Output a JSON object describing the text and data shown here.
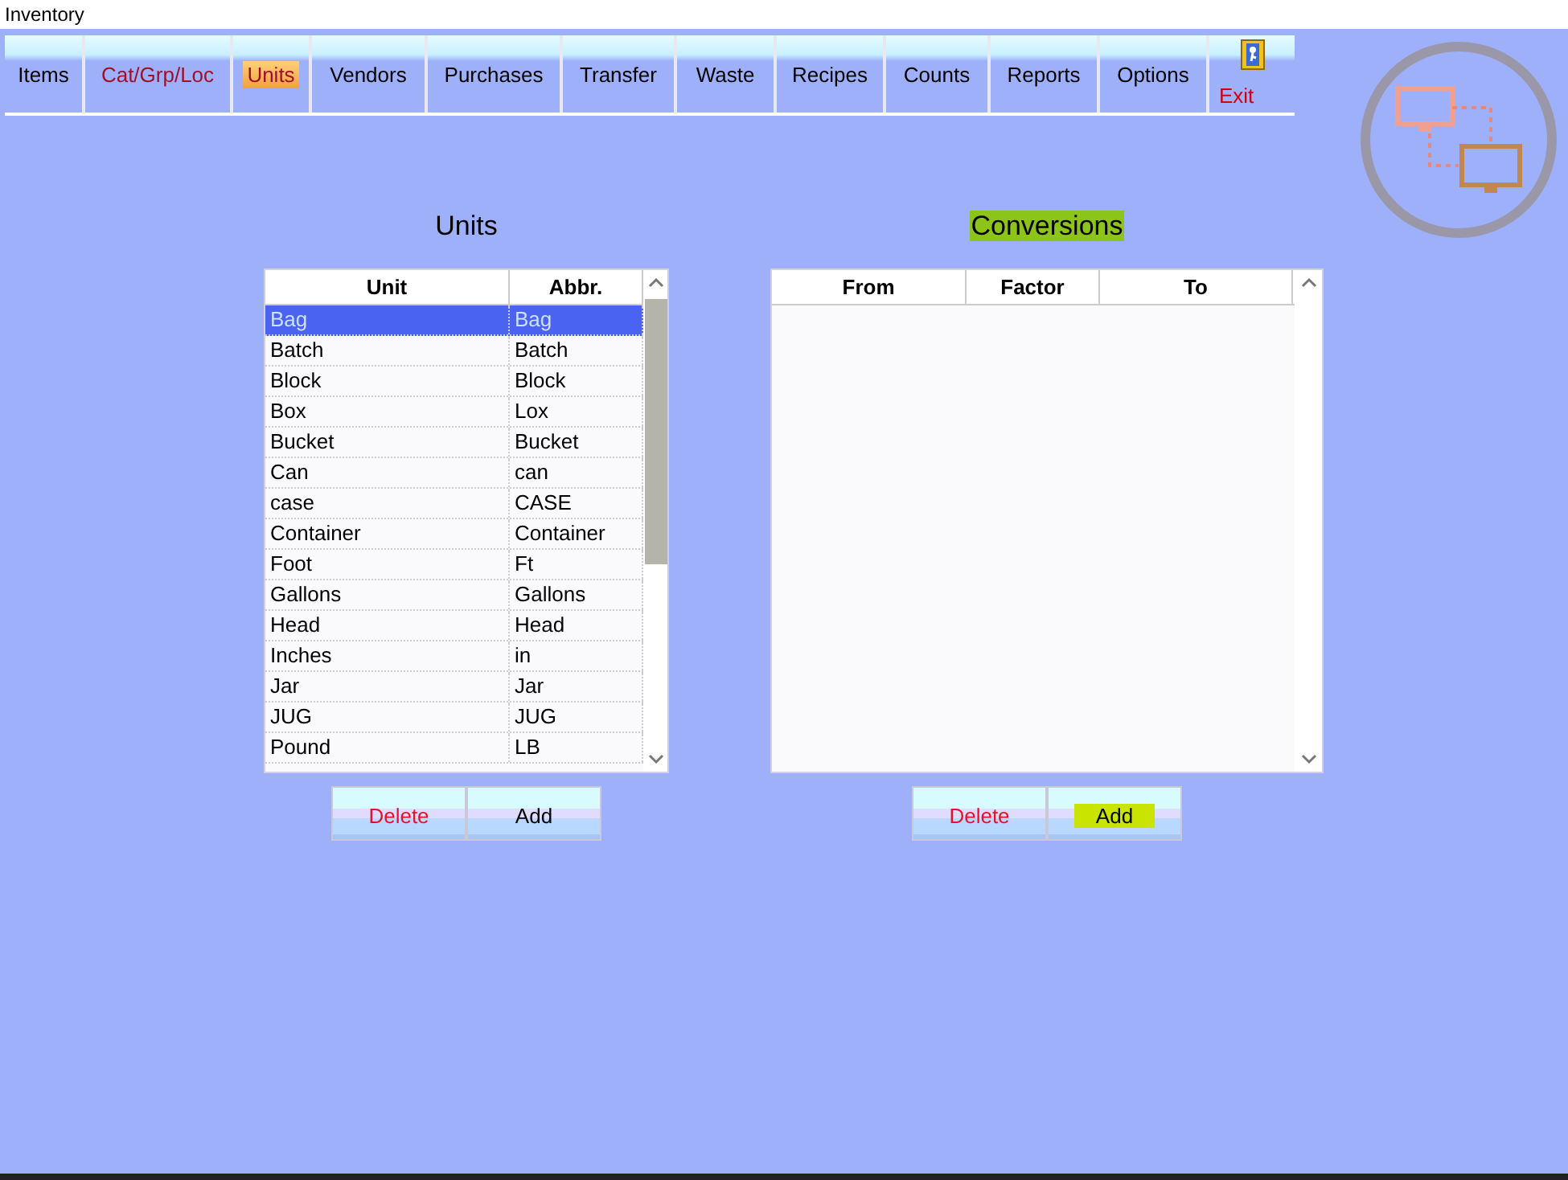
{
  "window": {
    "title": "Inventory"
  },
  "tabs": [
    {
      "label": "Items",
      "selected": false,
      "kind": "module"
    },
    {
      "label": "Cat/Grp/Loc",
      "selected": false,
      "kind": "setup"
    },
    {
      "label": "Units",
      "selected": true,
      "kind": "setup"
    },
    {
      "label": "Vendors",
      "selected": false,
      "kind": "module"
    },
    {
      "label": "Purchases",
      "selected": false,
      "kind": "module"
    },
    {
      "label": "Transfer",
      "selected": false,
      "kind": "module"
    },
    {
      "label": "Waste",
      "selected": false,
      "kind": "module"
    },
    {
      "label": "Recipes",
      "selected": false,
      "kind": "module"
    },
    {
      "label": "Counts",
      "selected": false,
      "kind": "module"
    },
    {
      "label": "Reports",
      "selected": false,
      "kind": "module"
    },
    {
      "label": "Options",
      "selected": false,
      "kind": "module"
    }
  ],
  "exit": {
    "label": "Exit"
  },
  "units": {
    "title": "Units",
    "highlighted": false,
    "columns": [
      "Unit",
      "Abbr."
    ],
    "rows": [
      {
        "unit": "Bag",
        "abbr": "Bag",
        "selected": true
      },
      {
        "unit": "Batch",
        "abbr": "Batch",
        "selected": false
      },
      {
        "unit": "Block",
        "abbr": "Block",
        "selected": false
      },
      {
        "unit": "Box",
        "abbr": "Lox",
        "selected": false
      },
      {
        "unit": "Bucket",
        "abbr": "Bucket",
        "selected": false
      },
      {
        "unit": "Can",
        "abbr": "can",
        "selected": false
      },
      {
        "unit": "case",
        "abbr": "CASE",
        "selected": false
      },
      {
        "unit": "Container",
        "abbr": "Container",
        "selected": false
      },
      {
        "unit": "Foot",
        "abbr": "Ft",
        "selected": false
      },
      {
        "unit": "Gallons",
        "abbr": "Gallons",
        "selected": false
      },
      {
        "unit": "Head",
        "abbr": "Head",
        "selected": false
      },
      {
        "unit": "Inches",
        "abbr": "in",
        "selected": false
      },
      {
        "unit": "Jar",
        "abbr": "Jar",
        "selected": false
      },
      {
        "unit": "JUG",
        "abbr": "JUG",
        "selected": false
      },
      {
        "unit": "Pound",
        "abbr": "LB",
        "selected": false
      }
    ],
    "buttons": [
      {
        "label": "Delete",
        "kind": "delete",
        "highlighted": false
      },
      {
        "label": "Add",
        "kind": "add",
        "highlighted": false
      }
    ]
  },
  "conversions": {
    "title": "Conversions",
    "highlighted": true,
    "columns": [
      "From",
      "Factor",
      "To"
    ],
    "buttons": [
      {
        "label": "Delete",
        "kind": "delete",
        "highlighted": false
      },
      {
        "label": "Add",
        "kind": "add",
        "highlighted": true
      }
    ]
  }
}
